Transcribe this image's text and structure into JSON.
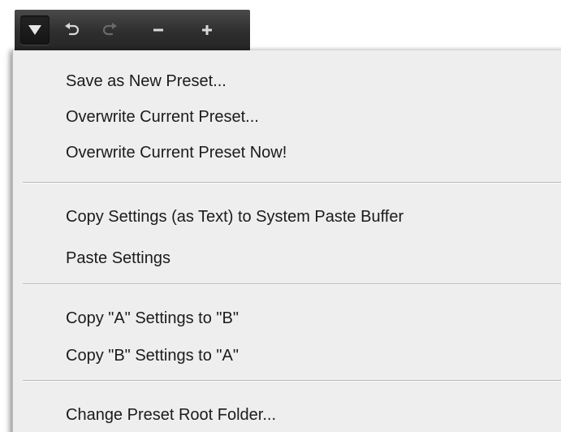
{
  "toolbar": {
    "buttons": [
      {
        "icon": "dropdown-triangle-icon"
      },
      {
        "icon": "undo-icon"
      },
      {
        "icon": "redo-icon"
      },
      {
        "icon": "minus-icon"
      },
      {
        "icon": "plus-icon"
      }
    ],
    "colors": {
      "bar": "#2e2e2e",
      "icon": "#d8d8d8",
      "icon_disabled": "#6a6a6a"
    }
  },
  "menu": {
    "groups": [
      {
        "items": [
          {
            "label": "Save as New Preset..."
          },
          {
            "label": "Overwrite Current Preset..."
          },
          {
            "label": "Overwrite Current Preset Now!"
          }
        ]
      },
      {
        "items": [
          {
            "label": "Copy Settings (as Text) to System Paste Buffer"
          },
          {
            "label": "Paste Settings"
          }
        ]
      },
      {
        "items": [
          {
            "label": "Copy \"A\" Settings to \"B\""
          },
          {
            "label": "Copy \"B\" Settings to \"A\""
          }
        ]
      },
      {
        "items": [
          {
            "label": "Change Preset Root Folder..."
          }
        ]
      }
    ],
    "colors": {
      "background": "#eeeeee",
      "text": "#1b1b1b",
      "separator": "#b9b9b9"
    }
  }
}
